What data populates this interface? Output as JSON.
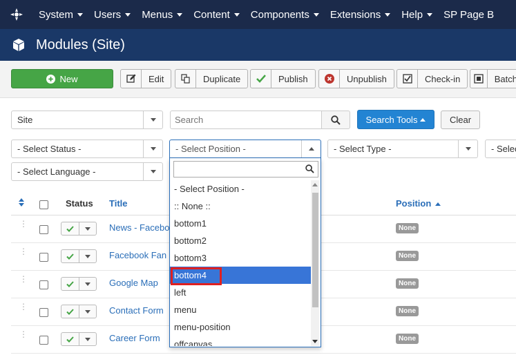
{
  "nav": {
    "items": [
      "System",
      "Users",
      "Menus",
      "Content",
      "Components",
      "Extensions",
      "Help",
      "SP Page B"
    ]
  },
  "header": {
    "title": "Modules (Site)"
  },
  "toolbar": {
    "new": "New",
    "edit": "Edit",
    "duplicate": "Duplicate",
    "publish": "Publish",
    "unpublish": "Unpublish",
    "checkin": "Check-in",
    "batch": "Batch"
  },
  "filters": {
    "client": "Site",
    "search_placeholder": "Search",
    "search_tools": "Search Tools",
    "clear": "Clear",
    "status": "- Select Status -",
    "position": "- Select Position -",
    "type": "- Select Type -",
    "access": "- Selec",
    "language": "- Select Language -"
  },
  "table": {
    "headers": {
      "status": "Status",
      "title": "Title",
      "position": "Position"
    },
    "rows": [
      {
        "title": "News - Facebo",
        "position": "None"
      },
      {
        "title": "Facebook Fan",
        "position": "None"
      },
      {
        "title": "Google Map",
        "position": "None"
      },
      {
        "title": "Contact Form",
        "position": "None"
      },
      {
        "title": "Career Form",
        "position": "None"
      }
    ]
  },
  "position_dropdown": {
    "search_value": "",
    "options": [
      "- Select Position -",
      ":: None ::",
      "bottom1",
      "bottom2",
      "bottom3",
      "bottom4",
      "left",
      "menu",
      "menu-position",
      "offcanvas"
    ],
    "highlighted": "bottom4"
  },
  "colors": {
    "nav_bg": "#1b2a4a",
    "header_bg": "#1a3867",
    "new_button": "#46a546",
    "search_tools_button": "#2384d3",
    "highlight": "#3875d7",
    "annotation_box": "#e02020"
  }
}
